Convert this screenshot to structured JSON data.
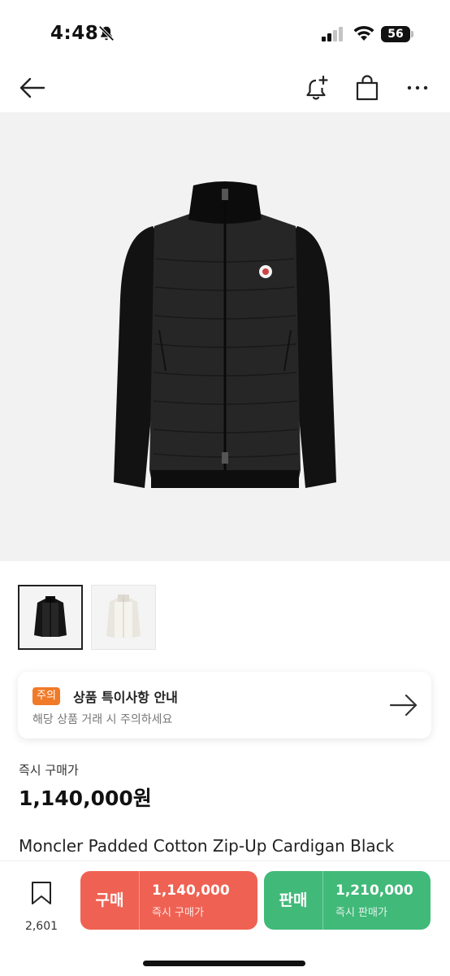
{
  "status_bar": {
    "time": "4:48",
    "battery": "56",
    "icons": [
      "bell-off-icon",
      "signal-icon",
      "wifi-icon",
      "battery-icon"
    ]
  },
  "nav": {
    "icons": [
      "back-arrow-icon",
      "alert-add-icon",
      "shopping-bag-icon",
      "more-icon"
    ]
  },
  "gallery": {
    "thumbnails": [
      "black jacket",
      "white jacket"
    ]
  },
  "notice": {
    "badge": "주의",
    "title": "상품 특이사항 안내",
    "subtitle": "해당 상품 거래 시 주의하세요"
  },
  "price": {
    "label": "즉시 구매가",
    "value": "1,140,000원"
  },
  "product": {
    "title": "Moncler Padded Cotton Zip-Up Cardigan Black"
  },
  "bottom_bar": {
    "bookmark_count": "2,601",
    "buy": {
      "label": "구매",
      "price": "1,140,000",
      "sub": "즉시 구매가"
    },
    "sell": {
      "label": "판매",
      "price": "1,210,000",
      "sub": "즉시 판매가"
    }
  },
  "colors": {
    "buy": "#ef6253",
    "sell": "#41b979",
    "notice_badge": "#f07a28",
    "hero_bg": "#f2f2f2"
  }
}
